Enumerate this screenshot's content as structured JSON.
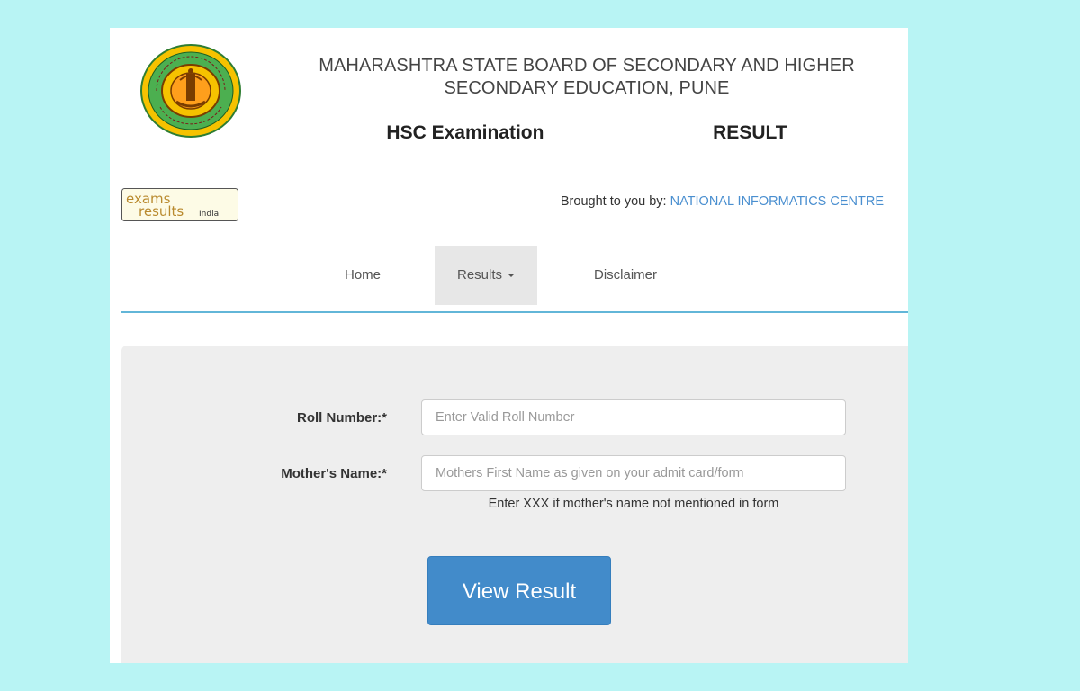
{
  "header": {
    "board_title_line1": "MAHARASHTRA STATE BOARD OF SECONDARY AND HIGHER",
    "board_title_line2": "SECONDARY EDUCATION, PUNE",
    "exam_title_left": "HSC Examination",
    "exam_title_right": "RESULT",
    "logo_text_exams": "exams",
    "logo_text_results": "results",
    "logo_text_india": "India",
    "brought_prefix": "Brought to you by: ",
    "brought_org": "NATIONAL INFORMATICS CENTRE"
  },
  "nav": {
    "home": "Home",
    "results": "Results",
    "disclaimer": "Disclaimer"
  },
  "form": {
    "roll_label": "Roll Number:*",
    "roll_placeholder": "Enter Valid Roll Number",
    "roll_value": "",
    "mother_label": "Mother's Name:*",
    "mother_placeholder": "Mothers First Name as given on your admit card/form",
    "mother_value": "",
    "mother_hint": "Enter XXX if mother's name not mentioned in form",
    "submit_label": "View Result"
  },
  "colors": {
    "background": "#b8f4f4",
    "link": "#4a8fd0",
    "button": "#428bca",
    "nav_underline": "#62b6d8"
  }
}
